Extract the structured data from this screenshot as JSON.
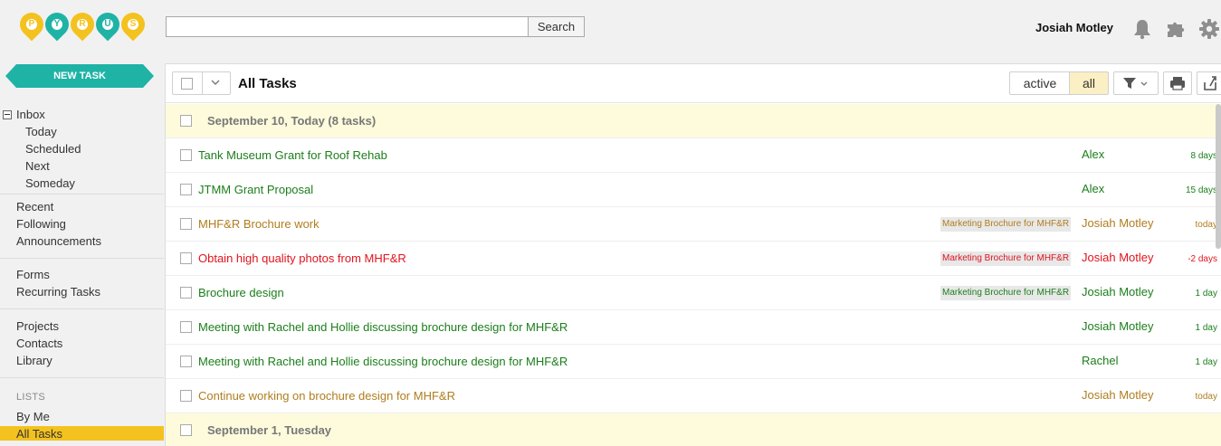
{
  "app": {
    "logo_letters": [
      "P",
      "Y",
      "R",
      "U",
      "S"
    ],
    "search_placeholder": "",
    "search_button": "Search",
    "user_name": "Josiah Motley",
    "icons": [
      "bell-icon",
      "puzzle-icon",
      "gear-icon"
    ]
  },
  "sidebar": {
    "new_task": "NEW TASK",
    "inbox": "Inbox",
    "inbox_items": [
      "Today",
      "Scheduled",
      "Next",
      "Someday"
    ],
    "group2": [
      "Recent",
      "Following",
      "Announcements"
    ],
    "group3": [
      "Forms",
      "Recurring Tasks"
    ],
    "group4": [
      "Projects",
      "Contacts",
      "Library"
    ],
    "lists_header": "LISTS",
    "lists": [
      "By Me",
      "All Tasks"
    ],
    "active_item": "All Tasks"
  },
  "main": {
    "title": "All Tasks",
    "filters": {
      "active": "active",
      "all": "all",
      "selected": "all"
    },
    "groups": [
      {
        "label": "September 10, Today (8 tasks)",
        "tasks": [
          {
            "name": "Tank Museum Grant for Roof Rehab",
            "tag": "",
            "assignee": "Alex",
            "due": "8 days",
            "color": "green"
          },
          {
            "name": "JTMM Grant Proposal",
            "tag": "",
            "assignee": "Alex",
            "due": "15 days",
            "color": "green"
          },
          {
            "name": "MHF&R Brochure work",
            "tag": "Marketing Brochure for MHF&R",
            "assignee": "Josiah Motley",
            "due": "today",
            "color": "olive"
          },
          {
            "name": "Obtain high quality photos from MHF&R",
            "tag": "Marketing Brochure for MHF&R",
            "assignee": "Josiah Motley",
            "due": "-2 days",
            "color": "red"
          },
          {
            "name": "Brochure design",
            "tag": "Marketing Brochure for MHF&R",
            "assignee": "Josiah Motley",
            "due": "1 day",
            "color": "green"
          },
          {
            "name": "Meeting with Rachel and Hollie discussing brochure design for MHF&R",
            "tag": "",
            "assignee": "Josiah Motley",
            "due": "1 day",
            "color": "green"
          },
          {
            "name": "Meeting with Rachel and Hollie discussing brochure design for MHF&R",
            "tag": "",
            "assignee": "Rachel",
            "due": "1 day",
            "color": "green"
          },
          {
            "name": "Continue working on brochure design for MHF&R",
            "tag": "",
            "assignee": "Josiah Motley",
            "due": "today",
            "color": "olive"
          }
        ]
      },
      {
        "label": "September 1, Tuesday",
        "tasks": []
      }
    ]
  },
  "colors": {
    "brand_yellow": "#f4c21f",
    "brand_teal": "#1fb3a6",
    "task_green": "#1b7e1b",
    "task_olive": "#b07d1e",
    "task_red": "#e0141d",
    "group_bg": "#fdfbdc"
  }
}
